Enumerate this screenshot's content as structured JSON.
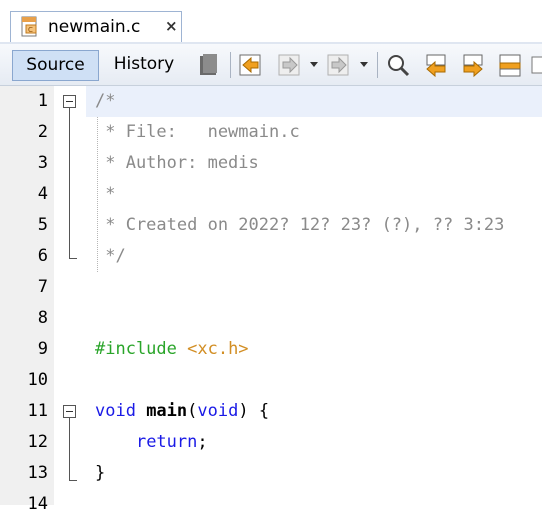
{
  "tab": {
    "file_name": "newmain.c",
    "close_glyph": "×",
    "icon": "c-source-file-icon"
  },
  "toolbar": {
    "source_label": "Source",
    "history_label": "History",
    "icons": [
      "last-edit-icon",
      "back-icon",
      "forward-icon",
      "find-icon",
      "find-previous-icon",
      "find-next-icon",
      "toggle-highlight-icon"
    ]
  },
  "editor": {
    "line_numbers": [
      "1",
      "2",
      "3",
      "4",
      "5",
      "6",
      "7",
      "8",
      "9",
      "10",
      "11",
      "12",
      "13",
      "14"
    ],
    "lines": [
      [
        {
          "t": "/*",
          "c": "comment"
        }
      ],
      [
        {
          "t": " * File:   newmain.c",
          "c": "comment"
        }
      ],
      [
        {
          "t": " * Author: medis",
          "c": "comment"
        }
      ],
      [
        {
          "t": " *",
          "c": "comment"
        }
      ],
      [
        {
          "t": " * Created on 2022? 12? 23? (?), ?? 3:23",
          "c": "comment"
        }
      ],
      [
        {
          "t": " */",
          "c": "comment"
        }
      ],
      [],
      [],
      [
        {
          "t": "#include ",
          "c": "directive"
        },
        {
          "t": "<xc.h>",
          "c": "header"
        }
      ],
      [],
      [
        {
          "t": "void ",
          "c": "kw"
        },
        {
          "t": "main",
          "c": "fn"
        },
        {
          "t": "(",
          "c": "plain"
        },
        {
          "t": "void",
          "c": "kw"
        },
        {
          "t": ") {",
          "c": "plain"
        }
      ],
      [
        {
          "t": "    ",
          "c": "plain"
        },
        {
          "t": "return",
          "c": "kw"
        },
        {
          "t": ";",
          "c": "plain"
        }
      ],
      [
        {
          "t": "}",
          "c": "plain"
        }
      ],
      []
    ]
  }
}
